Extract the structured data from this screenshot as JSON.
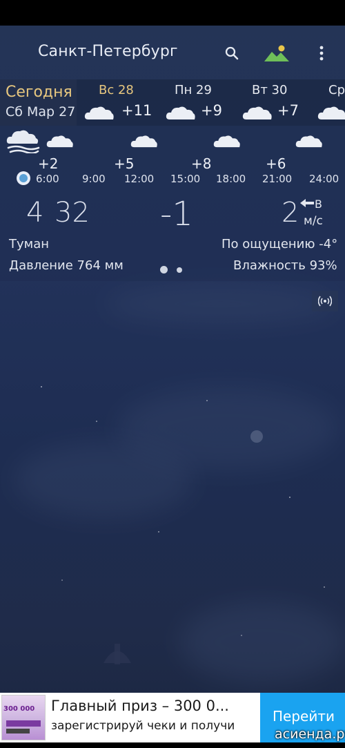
{
  "header": {
    "city": "Санкт-Петербург",
    "icons": [
      "search-icon",
      "landscape-icon",
      "more-vert-icon"
    ]
  },
  "days": {
    "today": {
      "label": "Сегодня",
      "date": "Сб Мар 27"
    },
    "items": [
      {
        "label": "Вс 28",
        "temp": "+11",
        "sunday": true
      },
      {
        "label": "Пн 29",
        "temp": "+9",
        "sunday": false
      },
      {
        "label": "Вт 30",
        "temp": "+7",
        "sunday": false
      },
      {
        "label": "Ср",
        "temp": "",
        "sunday": false
      }
    ]
  },
  "hourly": {
    "temps": [
      "+2",
      "+5",
      "+8",
      "+6"
    ],
    "times": [
      "6:00",
      "9:00",
      "12:00",
      "15:00",
      "18:00",
      "21:00",
      "24:00"
    ]
  },
  "current": {
    "time_hours": "4",
    "time_minutes": "32",
    "temperature": "-1",
    "wind_speed": "2",
    "wind_direction": "В",
    "wind_unit": "м/с",
    "condition": "Туман",
    "feels_like": "По ощущению -4°",
    "pressure": "Давление 764 мм",
    "humidity": "Влажность 93%"
  },
  "ad": {
    "thumb_text": "300 000",
    "title": "Главный приз – 300 0...",
    "subtitle": "зарегистрируй чеки и получи",
    "cta": "Перейти"
  },
  "watermark": "асиенда.ру",
  "colors": {
    "accent_gold": "#e7c77f",
    "ad_button": "#1aa3f0",
    "now_dot": "#5aa0d6"
  }
}
